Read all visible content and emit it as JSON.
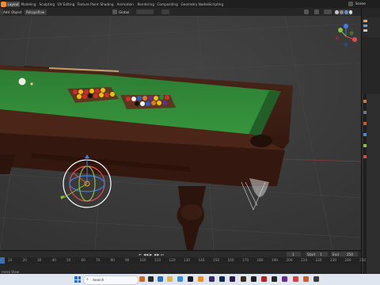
{
  "topbar": {
    "tabs": [
      "Layout",
      "Modeling",
      "Sculpting",
      "UV Editing",
      "Texture Paint",
      "Shading",
      "Animation",
      "Rendering",
      "Compositing",
      "Geometry Nodes",
      "Scripting"
    ],
    "scene_label": "Scene"
  },
  "viewport_header": {
    "mode": "Add",
    "menu_object": "Object",
    "overlay_select": "Retopoflow",
    "transform": "Global",
    "options": "Options",
    "select_label": "ect Bo"
  },
  "timeline": {
    "frame_ticks": [
      "10",
      "20",
      "30",
      "40",
      "50",
      "60",
      "70",
      "80",
      "90",
      "100",
      "110",
      "120",
      "130",
      "140",
      "150",
      "160",
      "170",
      "180",
      "190",
      "200",
      "210",
      "220",
      "230",
      "240",
      "250"
    ],
    "current_frame": "1",
    "start_label": "Start",
    "start_value": "1",
    "end_label": "End",
    "end_value": "250",
    "status_left": "mera View"
  },
  "taskbar": {
    "search_placeholder": "Search"
  },
  "colors": {
    "felt": "#2f8a36",
    "wood": "#3a1d14",
    "active_tab": "#474747",
    "gizmo_x": "#e6484f",
    "gizmo_y": "#8ac43e",
    "gizmo_z": "#3d7ce8"
  }
}
